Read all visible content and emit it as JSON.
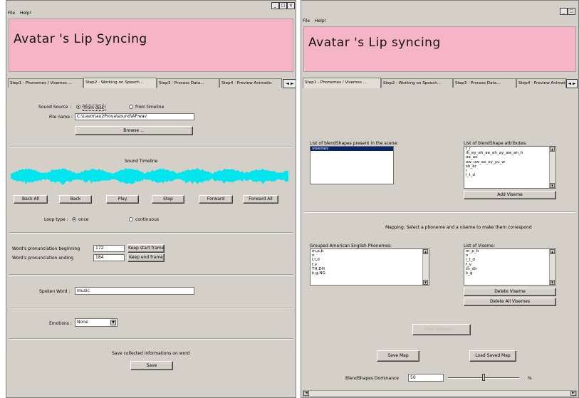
{
  "left_window": {
    "menu": [
      "File",
      "Help!"
    ],
    "window_buttons": [
      "_",
      "□",
      "x"
    ],
    "banner_title": "Avatar 's Lip Syncing",
    "tabs": [
      "Step1 - Phonemes / Visemes ...",
      "Step2 - Working on Speech...",
      "Step3 - Process Data...",
      "Step4 - Preview Animatio"
    ],
    "active_tab": 1,
    "tab_arrows": "◄ ►",
    "sound_source_label": "Sound Source :",
    "radio_from_disk": "from disk",
    "radio_from_timeline": "from timeline",
    "file_name_label": "File name :",
    "file_name_value": "C:\\Lavor\\au2Prova\\sound\\AP.wav",
    "browse_button": "Browse ...",
    "sound_timeline_label": "Sound Timeline",
    "waveform_color": "#00e5ee",
    "transport": [
      "Back All",
      "Back",
      "Play",
      "Stop",
      "Forward",
      "Forward All"
    ],
    "loop_type_label": "Loop type :",
    "loop_once": "once",
    "loop_continuous": "continuous",
    "pron_begin_label": "Word's pronunciation beginning",
    "pron_begin_value": "172",
    "keep_start_button": "Keep start frame",
    "pron_end_label": "Word's pronunciation ending",
    "pron_end_value": "184",
    "keep_end_button": "Keep end frame",
    "spoken_word_label": "Spoken Word :",
    "spoken_word_value": "music",
    "emotions_label": "Emotions :",
    "emotions_value": "None",
    "save_info_label": "Save collected informations on word",
    "save_button": "Save"
  },
  "right_window": {
    "menu": [
      "File",
      "Help!"
    ],
    "window_buttons": [
      "_",
      "□"
    ],
    "banner_title": "Avatar 's Lip syncing",
    "tabs": [
      "Step1 - Phonemes / Visemes ...",
      "Step2 - Working on Speech...",
      "Step3 - Process Data...",
      "Step4 - Preview Animati"
    ],
    "active_tab": 0,
    "tab_arrows": "◄ ►",
    "blendshapes_label": "List of blendShapes present in the scene:",
    "blendshapes_items": [
      "visemes"
    ],
    "blend_attrs_label": "List of blendShape attributes:",
    "blend_attrs_items": [
      "t_r",
      "ih_ey_eh_ae_ah_ay_aw_an_h",
      "aa_ao",
      "ow_uw_ax_oy_yu_w",
      "sh_er",
      "r",
      "l_t_d"
    ],
    "add_viseme_button": "Add Viseme",
    "mapping_label": "Mapping: Select a phoneme and a viseme to make them correspond",
    "phonemes_label": "Grouped American English Phonemes:",
    "phonemes_items": [
      "m,p,b",
      "n",
      "l,t,d",
      "f,v",
      "TH,DH",
      "k,g,NG"
    ],
    "visemes_label": "List of Viseme:",
    "visemes_items": [
      "m_p_b",
      "n",
      "l_t_d",
      "f_v",
      "th_dh",
      "k_g"
    ],
    "delete_viseme_button": "Delete Viseme",
    "delete_all_button": "Delete All Visemes",
    "map_between_button": "Map between...",
    "save_map_button": "Save Map",
    "load_map_button": "Load Saved Map",
    "dominance_label": "BlendShapes Dominance",
    "dominance_value": "50",
    "dominance_unit": "%",
    "dominance_slider_fraction": 0.5
  }
}
